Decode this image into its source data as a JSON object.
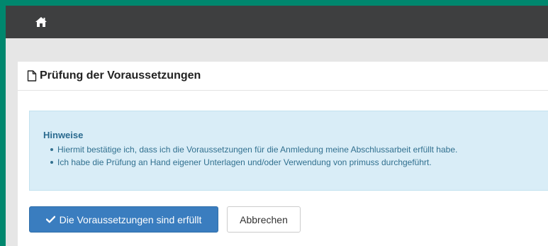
{
  "navbar": {
    "home_icon": "home-icon"
  },
  "panel": {
    "title_icon": "file-outline-icon",
    "title": "Prüfung der Voraussetzungen"
  },
  "notice": {
    "title": "Hinweise",
    "items": [
      "Hiermit bestätige ich, dass ich die Voraussetzungen für die Anmledung meine Abschlussarbeit erfüllt habe.",
      "Ich habe die Prüfung an Hand eigener Unterlagen und/oder Verwendung von primuss durchgeführt."
    ]
  },
  "actions": {
    "confirm_icon": "check-icon",
    "confirm_label": "Die Voraussetzungen sind erfüllt",
    "cancel_label": "Abbrechen"
  },
  "colors": {
    "frame": "#00876e",
    "navbar": "#3e3f40",
    "primary": "#3a7dbf",
    "info_bg": "#d9edf7",
    "info_text": "#31708f"
  }
}
